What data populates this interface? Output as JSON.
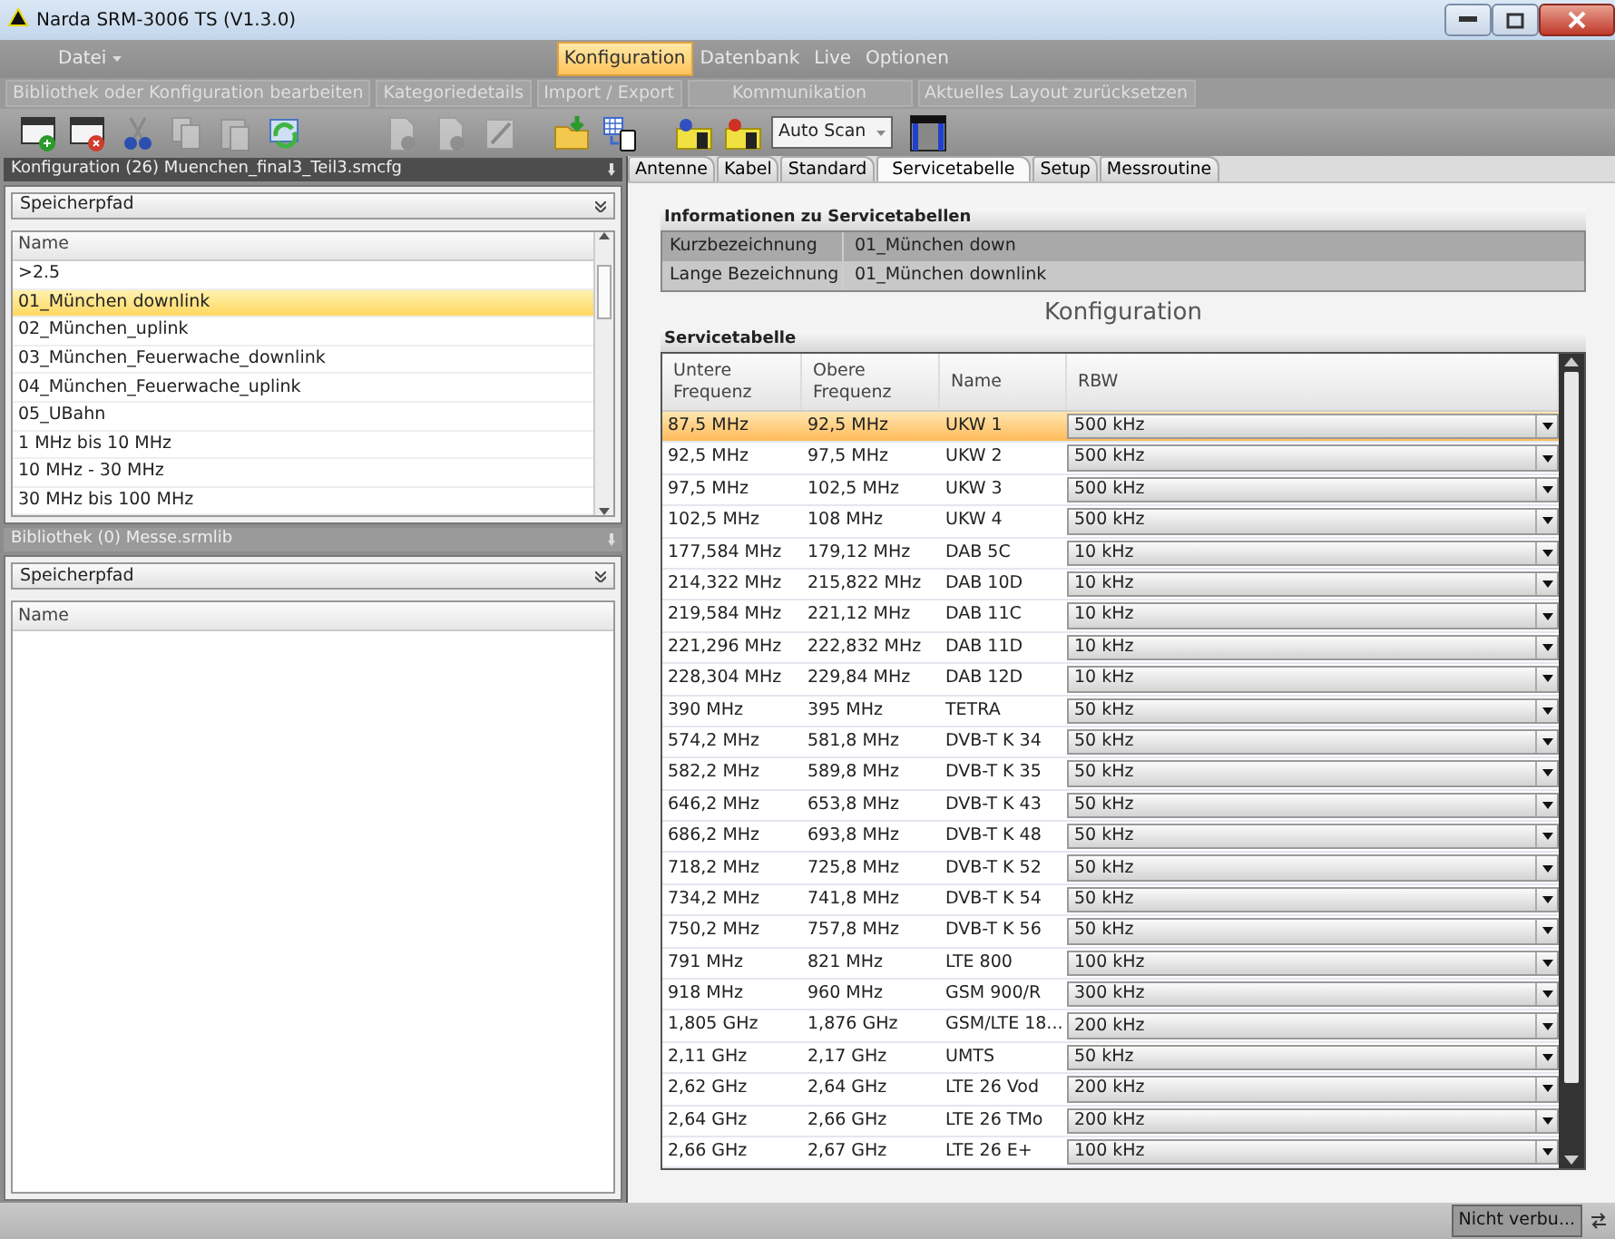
{
  "window": {
    "title": "Narda SRM-3006 TS  (V1.3.0)"
  },
  "menu": [
    {
      "label": "Datei",
      "kind": "dropdown",
      "selected": false
    },
    {
      "label": "Konfiguration",
      "kind": "tab",
      "selected": true
    },
    {
      "label": "Datenbank",
      "kind": "tab",
      "selected": false
    },
    {
      "label": "Live",
      "kind": "tab",
      "selected": false
    },
    {
      "label": "Optionen",
      "kind": "tab",
      "selected": false
    }
  ],
  "ribbon_groups": [
    "Bibliothek oder Konfiguration bearbeiten",
    "Kategoriedetails",
    "Import / Export",
    "Kommunikation",
    "Aktuelles Layout zurücksetzen"
  ],
  "toolbar": [
    {
      "items": [
        {
          "kind": "window-add",
          "disabled": false
        },
        {
          "kind": "window-remove",
          "disabled": false
        },
        {
          "kind": "cut",
          "disabled": false
        },
        {
          "kind": "copy",
          "disabled": true
        },
        {
          "kind": "paste",
          "disabled": true
        },
        {
          "kind": "refresh",
          "disabled": false
        }
      ]
    },
    {
      "items": [
        {
          "kind": "doc-add",
          "disabled": true
        },
        {
          "kind": "doc-remove",
          "disabled": true
        },
        {
          "kind": "edit",
          "disabled": true
        }
      ]
    },
    {
      "items": [
        {
          "kind": "import",
          "disabled": false
        },
        {
          "kind": "export",
          "disabled": false
        }
      ]
    },
    {
      "items": [
        {
          "kind": "device-load",
          "disabled": false
        },
        {
          "kind": "device-save",
          "disabled": false
        },
        {
          "kind": "combo",
          "value": "Auto Scan"
        }
      ]
    },
    {
      "items": [
        {
          "kind": "layout",
          "disabled": false
        }
      ]
    }
  ],
  "config_panel": {
    "title": "Konfiguration (26) Muenchen_final3_Teil3.smcfg",
    "path_header": "Speicherpfad",
    "column": "Name",
    "items": [
      {
        "label": ">2.5",
        "selected": false
      },
      {
        "label": "01_München downlink",
        "selected": true
      },
      {
        "label": "02_München_uplink",
        "selected": false
      },
      {
        "label": "03_München_Feuerwache_downlink",
        "selected": false
      },
      {
        "label": "04_München_Feuerwache_uplink",
        "selected": false
      },
      {
        "label": "05_UBahn",
        "selected": false
      },
      {
        "label": "1 MHz bis 10 MHz",
        "selected": false
      },
      {
        "label": "10 MHz - 30 MHz",
        "selected": false
      },
      {
        "label": "30 MHz bis 100 MHz",
        "selected": false
      }
    ]
  },
  "library_panel": {
    "title": "Bibliothek (0) Messe.srmlib",
    "path_header": "Speicherpfad",
    "column": "Name"
  },
  "tabs": [
    {
      "label": "Antenne",
      "selected": false
    },
    {
      "label": "Kabel",
      "selected": false
    },
    {
      "label": "Standard",
      "selected": false
    },
    {
      "label": "Servicetabelle",
      "selected": true
    },
    {
      "label": "Setup",
      "selected": false
    },
    {
      "label": "Messroutine",
      "selected": false
    }
  ],
  "info": {
    "title": "Informationen zu Servicetabellen",
    "rows": [
      {
        "label": "Kurzbezeichnung",
        "value": "01_München down",
        "selected": true
      },
      {
        "label": "Lange Bezeichnung",
        "value": "01_München downlink",
        "selected": false
      }
    ]
  },
  "section_title": "Konfiguration",
  "service_table": {
    "title": "Servicetabelle",
    "columns": [
      "Untere Frequenz",
      "Obere Frequenz",
      "Name",
      "RBW"
    ],
    "rows": [
      {
        "lower": "87,5 MHz",
        "upper": "92,5 MHz",
        "name": "UKW 1",
        "rbw": "500 kHz",
        "selected": true
      },
      {
        "lower": "92,5 MHz",
        "upper": "97,5 MHz",
        "name": "UKW 2",
        "rbw": "500 kHz",
        "selected": false
      },
      {
        "lower": "97,5 MHz",
        "upper": "102,5 MHz",
        "name": "UKW 3",
        "rbw": "500 kHz",
        "selected": false
      },
      {
        "lower": "102,5 MHz",
        "upper": "108 MHz",
        "name": "UKW 4",
        "rbw": "500 kHz",
        "selected": false
      },
      {
        "lower": "177,584 MHz",
        "upper": "179,12 MHz",
        "name": "DAB 5C",
        "rbw": "10 kHz",
        "selected": false
      },
      {
        "lower": "214,322 MHz",
        "upper": "215,822 MHz",
        "name": "DAB 10D",
        "rbw": "10 kHz",
        "selected": false
      },
      {
        "lower": "219,584 MHz",
        "upper": "221,12 MHz",
        "name": "DAB 11C",
        "rbw": "10 kHz",
        "selected": false
      },
      {
        "lower": "221,296 MHz",
        "upper": "222,832 MHz",
        "name": "DAB 11D",
        "rbw": "10 kHz",
        "selected": false
      },
      {
        "lower": "228,304 MHz",
        "upper": "229,84 MHz",
        "name": "DAB 12D",
        "rbw": "10 kHz",
        "selected": false
      },
      {
        "lower": "390 MHz",
        "upper": "395 MHz",
        "name": "TETRA",
        "rbw": "50 kHz",
        "selected": false
      },
      {
        "lower": "574,2 MHz",
        "upper": "581,8 MHz",
        "name": "DVB-T K 34",
        "rbw": "50 kHz",
        "selected": false
      },
      {
        "lower": "582,2 MHz",
        "upper": "589,8 MHz",
        "name": "DVB-T K 35",
        "rbw": "50 kHz",
        "selected": false
      },
      {
        "lower": "646,2 MHz",
        "upper": "653,8 MHz",
        "name": "DVB-T K 43",
        "rbw": "50 kHz",
        "selected": false
      },
      {
        "lower": "686,2 MHz",
        "upper": "693,8 MHz",
        "name": "DVB-T K 48",
        "rbw": "50 kHz",
        "selected": false
      },
      {
        "lower": "718,2 MHz",
        "upper": "725,8 MHz",
        "name": "DVB-T K 52",
        "rbw": "50 kHz",
        "selected": false
      },
      {
        "lower": "734,2 MHz",
        "upper": "741,8 MHz",
        "name": "DVB-T K 54",
        "rbw": "50 kHz",
        "selected": false
      },
      {
        "lower": "750,2 MHz",
        "upper": "757,8 MHz",
        "name": "DVB-T K 56",
        "rbw": "50 kHz",
        "selected": false
      },
      {
        "lower": "791 MHz",
        "upper": "821 MHz",
        "name": "LTE 800",
        "rbw": "100 kHz",
        "selected": false
      },
      {
        "lower": "918 MHz",
        "upper": "960 MHz",
        "name": "GSM 900/R",
        "rbw": "300 kHz",
        "selected": false
      },
      {
        "lower": "1,805 GHz",
        "upper": "1,876 GHz",
        "name": "GSM/LTE 18...",
        "rbw": "200 kHz",
        "selected": false
      },
      {
        "lower": "2,11 GHz",
        "upper": "2,17 GHz",
        "name": "UMTS",
        "rbw": "50 kHz",
        "selected": false
      },
      {
        "lower": "2,62 GHz",
        "upper": "2,64 GHz",
        "name": "LTE 26 Vod",
        "rbw": "200 kHz",
        "selected": false
      },
      {
        "lower": "2,64 GHz",
        "upper": "2,66 GHz",
        "name": "LTE 26 TMo",
        "rbw": "200 kHz",
        "selected": false
      },
      {
        "lower": "2,66 GHz",
        "upper": "2,67 GHz",
        "name": "LTE 26 E+",
        "rbw": "100 kHz",
        "selected": false
      }
    ]
  },
  "status_bar": {
    "connection": "Nicht verbu..."
  }
}
